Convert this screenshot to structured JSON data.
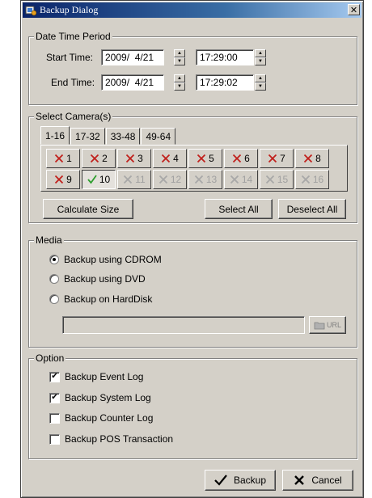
{
  "window": {
    "title": "Backup Dialog",
    "close_glyph": "✕"
  },
  "date_time": {
    "legend": "Date Time Period",
    "start_label": "Start Time:",
    "start_date": "2009/  4/21",
    "start_time": "17:29:00",
    "end_label": "End Time:",
    "end_date": "2009/  4/21",
    "end_time": "17:29:02"
  },
  "cameras": {
    "legend": "Select Camera(s)",
    "tabs": [
      "1-16",
      "17-32",
      "33-48",
      "49-64"
    ],
    "active_tab": "1-16",
    "items": [
      {
        "label": "1",
        "state": "unchecked"
      },
      {
        "label": "2",
        "state": "unchecked"
      },
      {
        "label": "3",
        "state": "unchecked"
      },
      {
        "label": "4",
        "state": "unchecked"
      },
      {
        "label": "5",
        "state": "unchecked"
      },
      {
        "label": "6",
        "state": "unchecked"
      },
      {
        "label": "7",
        "state": "unchecked"
      },
      {
        "label": "8",
        "state": "unchecked"
      },
      {
        "label": "9",
        "state": "unchecked"
      },
      {
        "label": "10",
        "state": "checked"
      },
      {
        "label": "11",
        "state": "disabled"
      },
      {
        "label": "12",
        "state": "disabled"
      },
      {
        "label": "13",
        "state": "disabled"
      },
      {
        "label": "14",
        "state": "disabled"
      },
      {
        "label": "15",
        "state": "disabled"
      },
      {
        "label": "16",
        "state": "disabled"
      }
    ],
    "calculate_label": "Calculate Size",
    "select_all_label": "Select All",
    "deselect_all_label": "Deselect All"
  },
  "media": {
    "legend": "Media",
    "options": [
      "Backup using CDROM",
      "Backup using DVD",
      "Backup on HardDisk"
    ],
    "selected": "Backup using CDROM",
    "path_value": "",
    "url_label": "URL"
  },
  "option": {
    "legend": "Option",
    "items": [
      {
        "label": "Backup Event Log",
        "checked": true
      },
      {
        "label": "Backup System Log",
        "checked": true
      },
      {
        "label": "Backup Counter Log",
        "checked": false
      },
      {
        "label": "Backup POS Transaction",
        "checked": false
      }
    ]
  },
  "footer": {
    "backup_label": "Backup",
    "cancel_label": "Cancel"
  },
  "colors": {
    "title_bar": "#0a246a",
    "check_green": "#2e9e2e",
    "cross_red": "#c0201c",
    "face": "#d4d0c8"
  }
}
